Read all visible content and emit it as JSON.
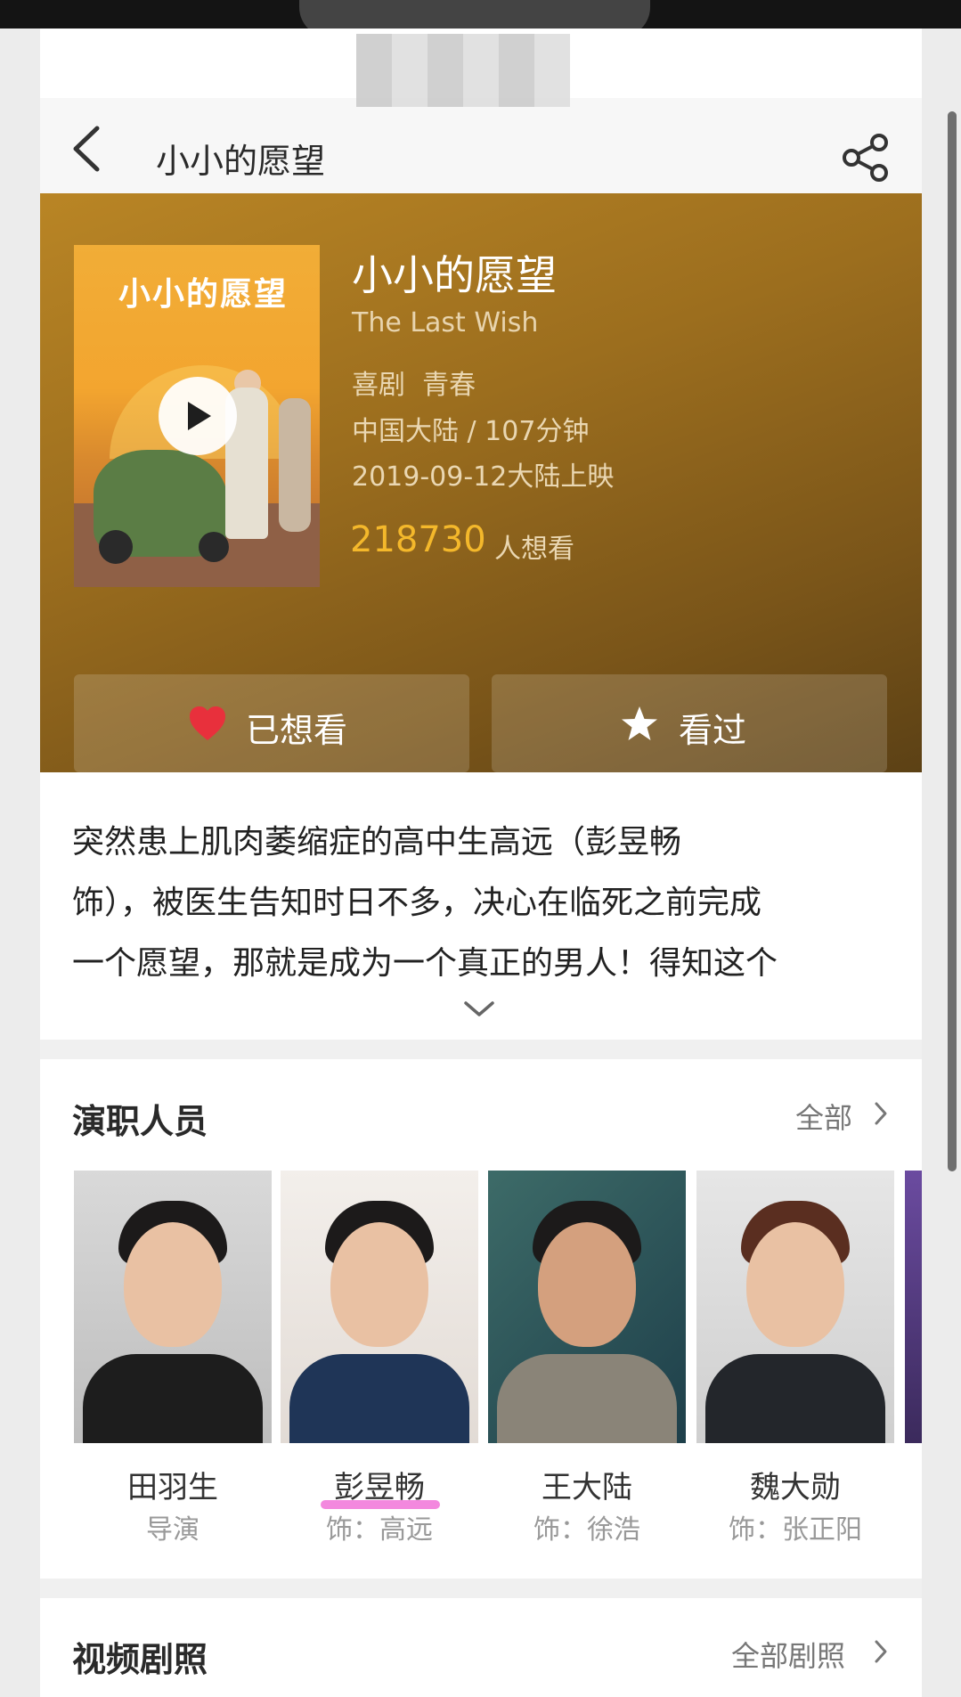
{
  "header": {
    "title": "小小的愿望"
  },
  "movie": {
    "title_cn": "小小的愿望",
    "title_en": "The Last Wish",
    "genres": "喜剧  青春",
    "region_duration": "中国大陆 / 107分钟",
    "release": "2019-09-12大陆上映",
    "want_count": "218730",
    "want_count_label": "人想看",
    "poster_title": "小小的愿望"
  },
  "actions": {
    "want_label": "已想看",
    "seen_label": "看过"
  },
  "synopsis": {
    "lines": [
      "突然患上肌肉萎缩症的高中生高远（彭昱畅",
      "饰），被医生告知时日不多，决心在临死之前完成",
      "一个愿望，那就是成为一个真正的男人！得知这个"
    ]
  },
  "cast_section": {
    "title": "演职人员",
    "more_label": "全部",
    "members": [
      {
        "name": "田羽生",
        "role": "导演"
      },
      {
        "name": "彭昱畅",
        "role": "饰：高远"
      },
      {
        "name": "王大陆",
        "role": "饰：徐浩"
      },
      {
        "name": "魏大勋",
        "role": "饰：张正阳"
      }
    ]
  },
  "video_section": {
    "title": "视频剧照",
    "more_label": "全部剧照"
  },
  "colors": {
    "accent_count": "#f4b82b",
    "heart": "#e8303c",
    "hero_bg": "#9c6e1e"
  }
}
